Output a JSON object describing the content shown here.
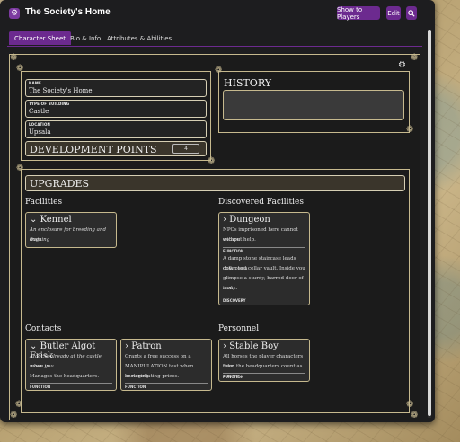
{
  "window": {
    "title": "The Society's Home"
  },
  "toolbar": {
    "show_players": "Show to Players",
    "edit": "Edit",
    "search_icon": "search-icon"
  },
  "tabs": [
    {
      "label": "Character Sheet",
      "active": true
    },
    {
      "label": "Bio & Info"
    },
    {
      "label": "Attributes & Abilities"
    }
  ],
  "fields": [
    {
      "label": "NAME",
      "value": "The Society's Home"
    },
    {
      "label": "TYPE OF BUILDING",
      "value": "Castle"
    },
    {
      "label": "LOCATION",
      "value": "Upsala"
    }
  ],
  "development_points": {
    "label": "DEVELOPMENT POINTS",
    "value": "4"
  },
  "history": {
    "title": "HISTORY"
  },
  "upgrades": {
    "title": "UPGRADES"
  },
  "sections": {
    "facilities": "Facilities",
    "discovered": "Discovered Facilities",
    "contacts": "Contacts",
    "personnel": "Personnel"
  },
  "cards": {
    "kennel": {
      "title": "Kennel",
      "lines": [
        "An enclosure for breeding and training",
        "dogs."
      ]
    },
    "dungeon": {
      "title": "Dungeon",
      "lines": [
        "NPCs imprisoned here cannot escape",
        "without help."
      ],
      "tag1": "FUNCTION",
      "lines2": [
        "A damp stone staircase leads down to a",
        "collapsed cellar vault. Inside you",
        "glimpse a sturdy, barred door of rusty",
        "iron..."
      ],
      "tag2": "DISCOVERY"
    },
    "butler": {
      "title": "Butler Algot Frisk",
      "lines": [
        "Algot is already at the castle when you",
        "move in."
      ],
      "lines2": [
        "Manages the headquarters."
      ],
      "tag": "FUNCTION"
    },
    "patron": {
      "title": "Patron",
      "lines": [
        "Grants a free success on a",
        "MANIPULATION test when bartering",
        "or negotiating prices."
      ],
      "tag": "FUNCTION"
    },
    "stableboy": {
      "title": "Stable Boy",
      "lines": [
        "All horses the player characters take",
        "from the headquarters count as strong."
      ],
      "tag": "FUNCTION"
    }
  },
  "colors": {
    "accent": "#6c2a8f",
    "border": "#c6b98e",
    "background": "#1d1d1f"
  }
}
